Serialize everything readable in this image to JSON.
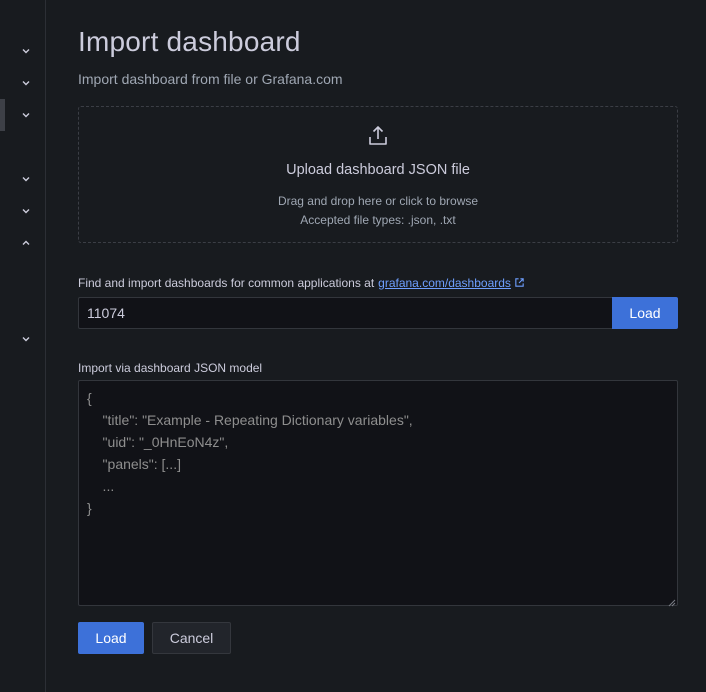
{
  "sidebar": {
    "chevrons": [
      {
        "icon": "chevron-down-icon"
      },
      {
        "icon": "chevron-down-icon"
      },
      {
        "icon": "chevron-down-icon"
      },
      {
        "icon": "chevron-down-icon"
      },
      {
        "icon": "chevron-down-icon"
      },
      {
        "icon": "chevron-up-icon"
      },
      {
        "icon": "chevron-down-icon"
      }
    ]
  },
  "page": {
    "title": "Import dashboard",
    "subtitle": "Import dashboard from file or Grafana.com"
  },
  "upload": {
    "icon": "upload-icon",
    "title": "Upload dashboard JSON file",
    "hint": "Drag and drop here or click to browse",
    "accepted": "Accepted file types: .json, .txt"
  },
  "find": {
    "label": "Find and import dashboards for common applications at",
    "link_text": "grafana.com/dashboards",
    "link_icon": "external-link-icon",
    "input_value": "11074",
    "load_label": "Load"
  },
  "json_model": {
    "label": "Import via dashboard JSON model",
    "lines": [
      "{",
      "    \"title\": \"Example - Repeating Dictionary variables\",",
      "    \"uid\": \"_0HnEoN4z\",",
      "    \"panels\": [...]",
      "    ...",
      "}"
    ]
  },
  "actions": {
    "load_label": "Load",
    "cancel_label": "Cancel"
  },
  "colors": {
    "primary": "#3d71d9",
    "link": "#6e9fff",
    "background": "#181b1f",
    "input_bg": "#111217"
  }
}
